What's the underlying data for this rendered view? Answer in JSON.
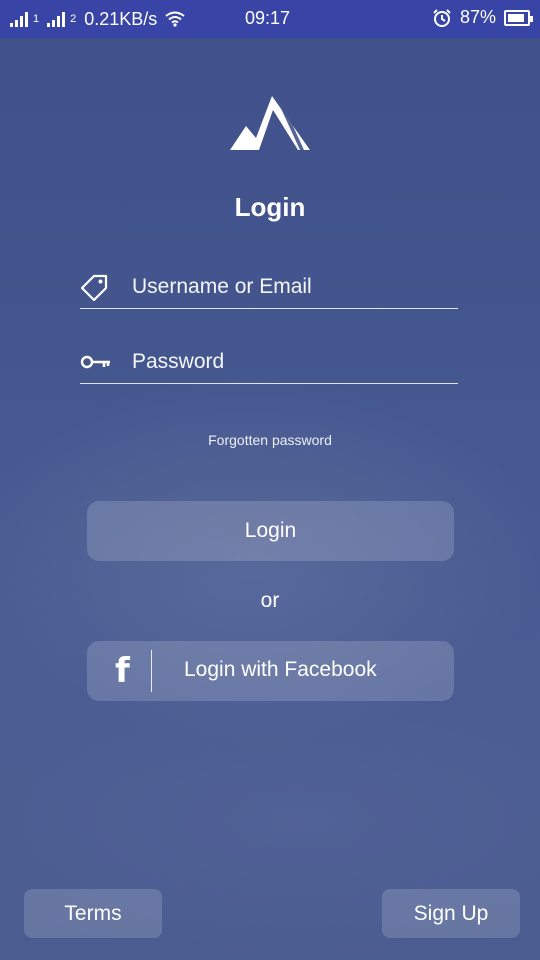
{
  "status_bar": {
    "sim1": "1",
    "sim2": "2",
    "speed": "0.21KB/s",
    "time": "09:17",
    "battery": "87%",
    "battery_level": 0.87,
    "icons": [
      "signal-icon",
      "wifi-icon",
      "alarm-icon",
      "battery-icon"
    ]
  },
  "header": {
    "logo_icon": "mountain-logo-icon",
    "title": "Login"
  },
  "form": {
    "username": {
      "placeholder": "Username or Email",
      "value": "",
      "icon": "tag-icon"
    },
    "password": {
      "placeholder": "Password",
      "value": "",
      "icon": "key-icon"
    },
    "forgot_label": "Forgotten password",
    "login_label": "Login",
    "or_label": "or",
    "facebook_label": "Login with Facebook",
    "facebook_icon": "facebook-icon",
    "facebook_glyph": "f"
  },
  "footer": {
    "terms_label": "Terms",
    "signup_label": "Sign Up"
  },
  "colors": {
    "status_bar": "#3845a6",
    "background": "#44548c"
  }
}
